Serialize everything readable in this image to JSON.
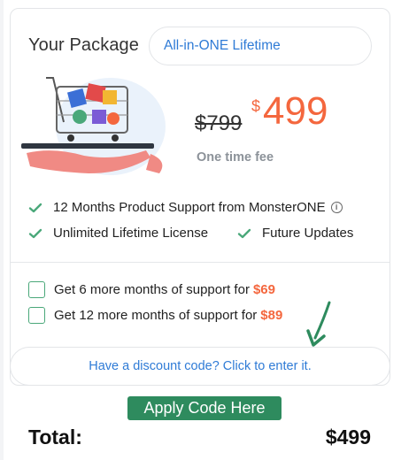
{
  "package": {
    "label": "Your Package",
    "selected": "All-in-ONE Lifetime"
  },
  "pricing": {
    "old_price": "$799",
    "currency": "$",
    "new_price": "499",
    "note": "One time fee"
  },
  "features": [
    {
      "text": "12 Months Product Support from MonsterONE",
      "icon": "check-icon"
    },
    {
      "text": "Unlimited Lifetime License",
      "icon": "check-icon"
    },
    {
      "text": "Future Updates",
      "icon": "check-icon"
    }
  ],
  "info_icon": "i",
  "addons": [
    {
      "text": "Get 6 more months of support for",
      "price": "$69",
      "checked": false
    },
    {
      "text": "Get 12 more months of support for",
      "price": "$89",
      "checked": false
    }
  ],
  "discount": {
    "label": "Have a discount code? Click to enter it."
  },
  "apply_button": "Apply Code Here",
  "total": {
    "label": "Total:",
    "value": "$499"
  },
  "colors": {
    "accent_orange": "#f4673e",
    "link_blue": "#2f7bd6",
    "check_green": "#4aa87a",
    "button_green": "#2e8b5e"
  }
}
